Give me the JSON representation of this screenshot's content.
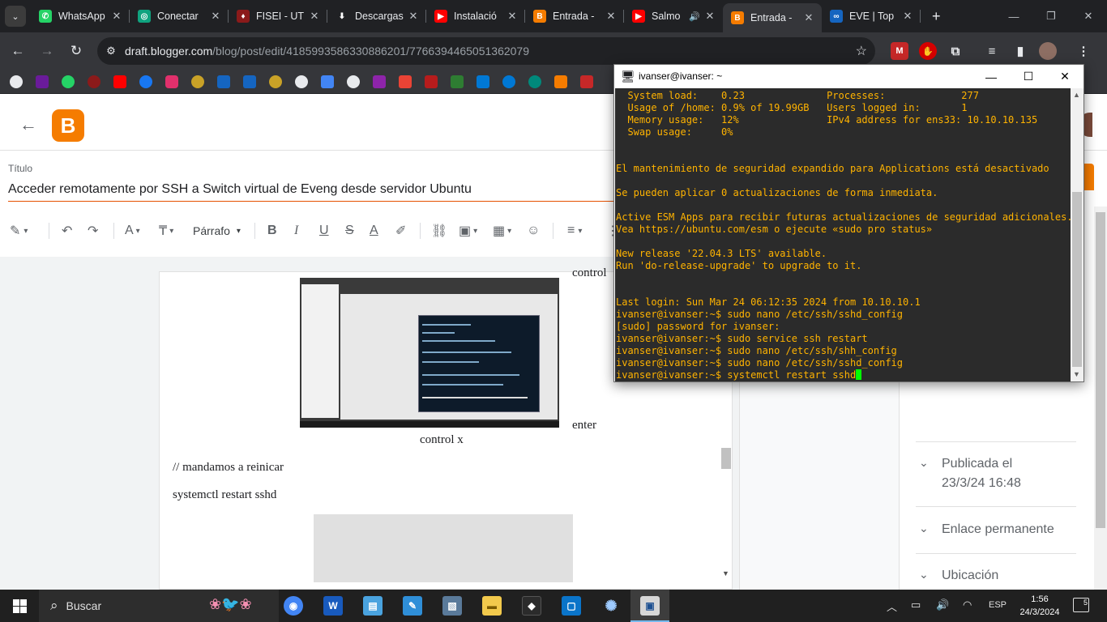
{
  "browser": {
    "tabs": [
      {
        "title": "WhatsApp",
        "color": "#25d366",
        "glyph": "✆"
      },
      {
        "title": "Conectar",
        "color": "#10a37f",
        "glyph": "◎"
      },
      {
        "title": "FISEI - UT",
        "color": "#8b1a1a",
        "glyph": "♦"
      },
      {
        "title": "Descargas",
        "color": "#202124",
        "glyph": "⬇"
      },
      {
        "title": "Instalació",
        "color": "#ff0000",
        "glyph": "▶"
      },
      {
        "title": "Entrada -",
        "color": "#f57c00",
        "glyph": "B"
      },
      {
        "title": "Salmo",
        "color": "#ff0000",
        "glyph": "▶",
        "extra": "🔊"
      },
      {
        "title": "Entrada -",
        "color": "#f57c00",
        "glyph": "B"
      },
      {
        "title": "EVE | Top",
        "color": "#1565c0",
        "glyph": "∞"
      }
    ],
    "url_host": "draft.blogger.com",
    "url_path": "/blog/post/edit/4185993586330886201/7766394465051362079"
  },
  "blogger": {
    "title_label": "Título",
    "title_value": "Acceder remotamente por SSH a Switch virtual de Eveng desde servidor Ubuntu",
    "toolbar_paragraph": "Párrafo",
    "body": {
      "top_text": "control",
      "enter_text": "enter",
      "control_x": "control x",
      "comment": "// mandamos a reinicar",
      "command": "systemctl restart sshd"
    },
    "settings": {
      "published_label": "Publicada el",
      "published_value": "23/3/24 16:48",
      "permalink": "Enlace permanente",
      "location": "Ubicación"
    }
  },
  "terminal": {
    "window_title": "ivanser@ivanser: ~",
    "lines": [
      "  System load:    0.23              Processes:             277",
      "  Usage of /home: 0.9% of 19.99GB   Users logged in:       1",
      "  Memory usage:   12%               IPv4 address for ens33: 10.10.10.135",
      "  Swap usage:     0%",
      "",
      "",
      "El mantenimiento de seguridad expandido para Applications está desactivado",
      "",
      "Se pueden aplicar 0 actualizaciones de forma inmediata.",
      "",
      "Active ESM Apps para recibir futuras actualizaciones de seguridad adicionales.",
      "Vea https://ubuntu.com/esm o ejecute «sudo pro status»",
      "",
      "New release '22.04.3 LTS' available.",
      "Run 'do-release-upgrade' to upgrade to it.",
      "",
      "",
      "Last login: Sun Mar 24 06:12:35 2024 from 10.10.10.1",
      "ivanser@ivanser:~$ sudo nano /etc/ssh/sshd_config",
      "[sudo] password for ivanser:",
      "ivanser@ivanser:~$ sudo service ssh restart",
      "ivanser@ivanser:~$ sudo nano /etc/ssh/shh_config",
      "ivanser@ivanser:~$ sudo nano /etc/ssh/sshd_config"
    ],
    "current_line": "ivanser@ivanser:~$ systemctl restart sshd"
  },
  "taskbar": {
    "search_placeholder": "Buscar",
    "language": "ESP",
    "time": "1:56",
    "date": "24/3/2024",
    "notifications": "5"
  }
}
